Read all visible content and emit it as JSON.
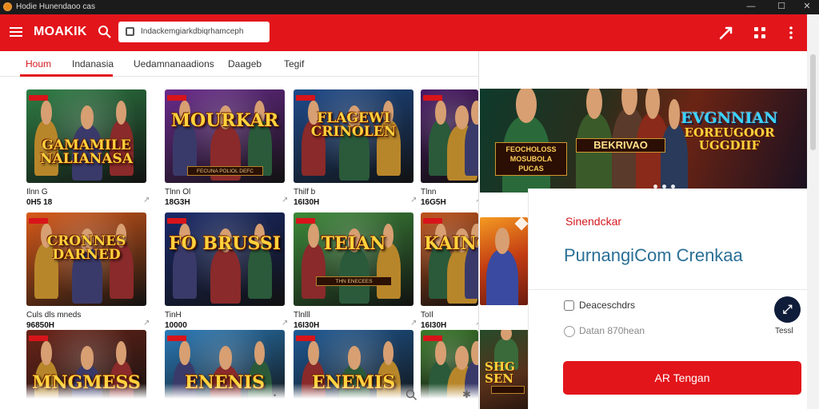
{
  "window": {
    "title": "Hodie Hunendaoo cas",
    "minimize": "—",
    "maximize": "☐",
    "close": "✕"
  },
  "header": {
    "brand": "MOAKIK",
    "url": "Indackemgiarkdbiqrhamceph",
    "icons": [
      "share-icon",
      "grid-icon",
      "more-icon"
    ]
  },
  "tabs": [
    {
      "label": "Houm",
      "active": true
    },
    {
      "label": "Indanasia",
      "active": false
    },
    {
      "label": "Uedamnanaadions",
      "active": false
    },
    {
      "label": "Daageb",
      "active": false
    },
    {
      "label": "Tegif",
      "active": false
    }
  ],
  "cards": [
    {
      "thumb_text": "GAMAMILE NALIANASA",
      "banner": "",
      "title": "Ilnn G",
      "stat": "0H5 18",
      "bg": "#2e7d44"
    },
    {
      "thumb_text": "MOURKAR",
      "banner": "FECUNA POLIOL DEFC",
      "title": "Tlnn Ol",
      "stat": "18G3H",
      "bg": "#6a2b8c"
    },
    {
      "thumb_text": "FLAGEWI CRINOLEN",
      "banner": "",
      "title": "Thilf b",
      "stat": "16I30H",
      "bg": "#1e4b8c"
    },
    {
      "thumb_text": "",
      "banner": "",
      "title": "Tlnn",
      "stat": "16G5H",
      "bg": "#4a1a66"
    },
    {
      "thumb_text": "CRONNES DARNED",
      "banner": "",
      "title": "Culs dls mneds",
      "stat": "96850H",
      "bg": "#d85a1a"
    },
    {
      "thumb_text": "FO BRUSSI",
      "banner": "",
      "title": "TinH",
      "stat": "10000",
      "bg": "#1a2a6a"
    },
    {
      "thumb_text": "TEIAN",
      "banner": "THN ENECEES",
      "title": "Tlnlll",
      "stat": "16I30H",
      "bg": "#3e8a3a"
    },
    {
      "thumb_text": "KAINOB",
      "banner": "",
      "title": "ToIl",
      "stat": "16I30H",
      "bg": "#c0521a"
    },
    {
      "thumb_text": "MNGMESS",
      "banner": "",
      "title": "",
      "stat": "",
      "bg": "#6b2418"
    },
    {
      "thumb_text": "ENENIS",
      "banner": "",
      "title": "",
      "stat": "",
      "bg": "#2a7ab8"
    },
    {
      "thumb_text": "ENEMIS",
      "banner": "",
      "title": "",
      "stat": "",
      "bg": "#1f5a96"
    },
    {
      "thumb_text": "",
      "banner": "",
      "title": "",
      "stat": "",
      "bg": "#3a7a2a"
    }
  ],
  "hero": {
    "title_line1": "EVGNNIAN",
    "title_line2": "EOREUGOOR UGGDIIF",
    "badge_left": "FEOCHOLOSS MOSUBOLA PUCAS",
    "badge_mid": "BEKRIVAO"
  },
  "panel": {
    "heading": "Sinendckar",
    "big": "PurnangiCom Crenkaa",
    "option1": "Deaceschdrs",
    "option2": "Datan 870hean",
    "fab_label": "Tessl",
    "cta": "AR Tengan"
  },
  "side": {
    "text": "SHG SEN"
  }
}
